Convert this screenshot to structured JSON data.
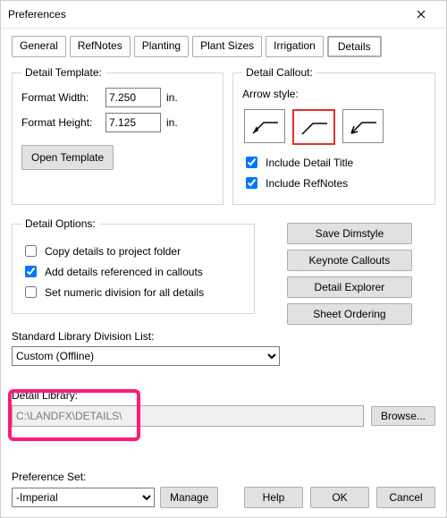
{
  "window": {
    "title": "Preferences"
  },
  "tabs": {
    "general": "General",
    "refnotes": "RefNotes",
    "planting": "Planting",
    "plant_sizes": "Plant Sizes",
    "irrigation": "Irrigation",
    "details": "Details"
  },
  "detail_template": {
    "legend": "Detail Template:",
    "format_width_label": "Format Width:",
    "format_width_value": "7.250",
    "format_height_label": "Format Height:",
    "format_height_value": "7.125",
    "unit": "in.",
    "open_template": "Open Template"
  },
  "detail_callout": {
    "legend": "Detail Callout:",
    "arrow_style_label": "Arrow style:",
    "include_title": "Include Detail Title",
    "include_refnotes": "Include RefNotes"
  },
  "detail_options": {
    "legend": "Detail Options:",
    "copy_to_project": "Copy details to project folder",
    "add_referenced": "Add details referenced in callouts",
    "set_numeric": "Set numeric division for all details"
  },
  "buttons": {
    "save_dimstyle": "Save Dimstyle",
    "keynote_callouts": "Keynote Callouts",
    "detail_explorer": "Detail Explorer",
    "sheet_ordering": "Sheet Ordering"
  },
  "std_lib": {
    "label": "Standard Library Division List:",
    "value": "Custom (Offline)"
  },
  "detail_library": {
    "label": "Detail Library:",
    "path": "C:\\LANDFX\\DETAILS\\",
    "browse": "Browse..."
  },
  "pref_set": {
    "label": "Preference Set:",
    "value": "-Imperial",
    "manage": "Manage"
  },
  "dlg_buttons": {
    "help": "Help",
    "ok": "OK",
    "cancel": "Cancel"
  }
}
